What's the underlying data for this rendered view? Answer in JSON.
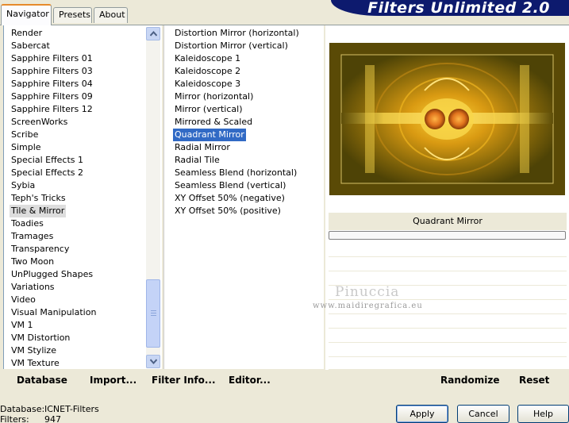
{
  "tabs": [
    {
      "label": "Navigator"
    },
    {
      "label": "Presets"
    },
    {
      "label": "About"
    }
  ],
  "banner": {
    "title": "Filters Unlimited 2.0"
  },
  "categories": [
    "Render",
    "Sabercat",
    "Sapphire Filters 01",
    "Sapphire Filters 03",
    "Sapphire Filters 04",
    "Sapphire Filters 09",
    "Sapphire Filters 12",
    "ScreenWorks",
    "Scribe",
    "Simple",
    "Special Effects 1",
    "Special Effects 2",
    "Sybia",
    "Teph's Tricks",
    "Tile & Mirror",
    "Toadies",
    "Tramages",
    "Transparency",
    "Two Moon",
    "UnPlugged Shapes",
    "Variations",
    "Video",
    "Visual Manipulation",
    "VM 1",
    "VM Distortion",
    "VM Stylize",
    "VM Texture"
  ],
  "selected_category": "Tile & Mirror",
  "filters": [
    "Distortion Mirror (horizontal)",
    "Distortion Mirror (vertical)",
    "Kaleidoscope 1",
    "Kaleidoscope 2",
    "Kaleidoscope 3",
    "Mirror (horizontal)",
    "Mirror (vertical)",
    "Mirrored & Scaled",
    "Quadrant Mirror",
    "Radial Mirror",
    "Radial Tile",
    "Seamless Blend (horizontal)",
    "Seamless Blend (vertical)",
    "XY Offset 50% (negative)",
    "XY Offset 50% (positive)"
  ],
  "selected_filter": "Quadrant Mirror",
  "preview": {
    "filter_name": "Quadrant Mirror"
  },
  "watermark": {
    "name": "Pinuccia",
    "url": "www.maidiregrafica.eu"
  },
  "toolbar": {
    "database_label": "Database",
    "import_label": "Import...",
    "filter_info_label": "Filter Info...",
    "editor_label": "Editor...",
    "randomize_label": "Randomize",
    "reset_label": "Reset"
  },
  "status": {
    "database_key": "Database:",
    "database_value": "ICNET-Filters",
    "filters_key": "Filters:",
    "filters_value": "947"
  },
  "dialog": {
    "apply_label": "Apply",
    "cancel_label": "Cancel",
    "help_label": "Help"
  },
  "scroll": {
    "position": 0.85
  }
}
